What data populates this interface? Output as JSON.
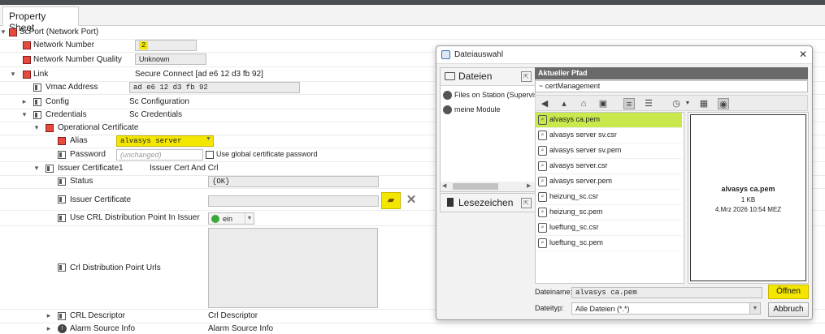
{
  "tab": {
    "label": "Property Sheet"
  },
  "tree": {
    "root": {
      "label": "ScPort  (Network Port)"
    },
    "network_number": {
      "label": "Network Number",
      "value": "2"
    },
    "network_number_quality": {
      "label": "Network Number Quality",
      "value": "Unknown"
    },
    "link": {
      "label": "Link",
      "value": "Secure Connect [ad e6 12 d3 fb 92]"
    },
    "vmac_address": {
      "label": "Vmac Address",
      "value": "ad e6 12 d3 fb 92"
    },
    "config": {
      "label": "Config",
      "value": "Sc Configuration"
    },
    "credentials": {
      "label": "Credentials",
      "value": "Sc Credentials"
    },
    "operational_certificate": {
      "label": "Operational Certificate"
    },
    "alias": {
      "label": "Alias",
      "value": "alvasys server"
    },
    "password": {
      "label": "Password",
      "placeholder": "(unchanged)",
      "checkbox_label": "Use global certificate password"
    },
    "issuer_certificate1": {
      "label": "Issuer Certificate1",
      "value": "Issuer Cert And Crl"
    },
    "status": {
      "label": "Status",
      "value": "{OK}"
    },
    "issuer_certificate": {
      "label": "Issuer Certificate",
      "value": ""
    },
    "use_crl": {
      "label": "Use CRL Distribution Point In Issuer",
      "value": "ein"
    },
    "crl_urls": {
      "label": "Crl Distribution Point Urls"
    },
    "crl_descriptor": {
      "label": "CRL Descriptor",
      "value": "Crl Descriptor"
    },
    "alarm_source_info": {
      "label": "Alarm Source Info",
      "value": "Alarm Source Info"
    }
  },
  "dialog": {
    "title": "Dateiauswahl",
    "close": "✕",
    "left_panel": {
      "header": "Dateien",
      "items": [
        "Files on Station (Supervis",
        "meine Module"
      ],
      "bookmarks_header": "Lesezeichen"
    },
    "path_label": "Aktueller Pfad",
    "path_value": "~ certManagement",
    "files": [
      "alvasys ca.pem",
      "alvasys server sv.csr",
      "alvasys server sv.pem",
      "alvasys server.csr",
      "alvasys server.pem",
      "heizung_sc.csr",
      "heizung_sc.pem",
      "lueftung_sc.csr",
      "lueftung_sc.pem"
    ],
    "preview": {
      "name": "alvasys ca.pem",
      "size": "1 KB",
      "date": "4.Mrz 2026 10:54 MEZ"
    },
    "filename_label": "Dateiname:",
    "filename_value": "alvasys ca.pem",
    "filetype_label": "Dateityp:",
    "filetype_value": "Alle Dateien (*.*)",
    "open_button": "Öffnen",
    "cancel_button": "Abbruch"
  },
  "colors": {
    "highlight": "#f3e600",
    "selected_file": "#c8e84c",
    "path_header": "#6a6a6a"
  }
}
